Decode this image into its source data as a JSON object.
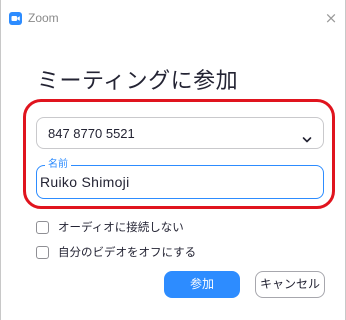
{
  "window": {
    "title": "Zoom",
    "close_glyph": "×"
  },
  "dialog": {
    "heading": "ミーティングに参加",
    "meeting_id": {
      "value": "847 8770 5521"
    },
    "name_field": {
      "legend": "名前",
      "value": "Ruiko Shimoji"
    },
    "options": [
      {
        "label": "オーディオに接続しない",
        "checked": false
      },
      {
        "label": "自分のビデオをオフにする",
        "checked": false
      }
    ],
    "buttons": {
      "join_label": "参加",
      "cancel_label": "キャンセル"
    }
  },
  "colors": {
    "accent": "#2d8cff",
    "highlight": "#e0141e",
    "text": "#232333"
  },
  "icons": {
    "app": "zoom-camera-icon",
    "dropdown": "chevron-down-icon",
    "close": "close-icon"
  }
}
